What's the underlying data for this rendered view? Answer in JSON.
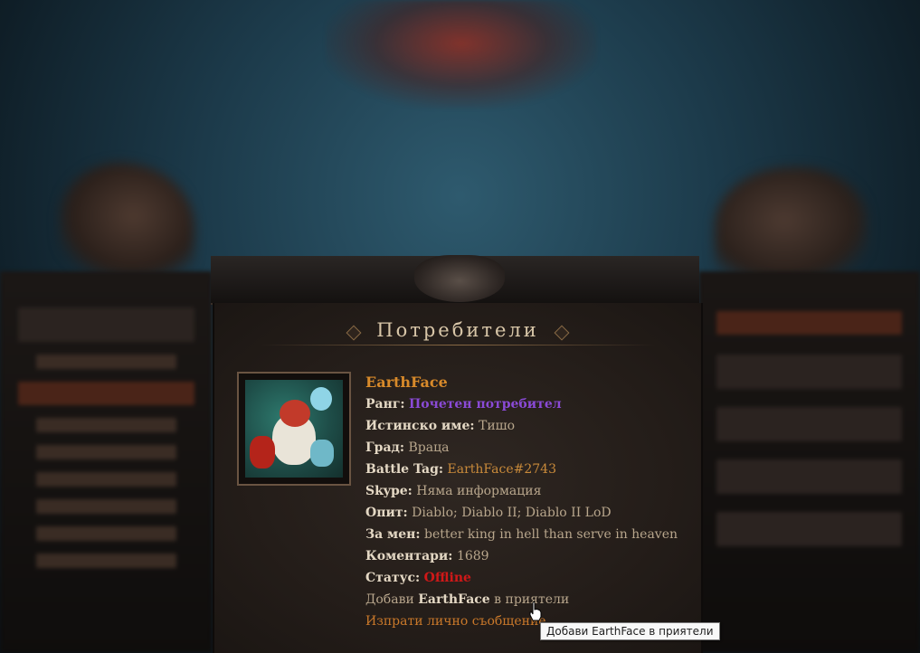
{
  "page": {
    "title": "Потребители"
  },
  "profile": {
    "username": "EarthFace",
    "rank_label": "Ранг:",
    "rank_value": "Почетен потребител",
    "real_name_label": "Истинско име:",
    "real_name_value": "Тишо",
    "city_label": "Град:",
    "city_value": "Враца",
    "battletag_label": "Battle Tag:",
    "battletag_value": "EarthFace#2743",
    "skype_label": "Skype:",
    "skype_value": "Няма информация",
    "experience_label": "Опит:",
    "experience_value": "Diablo; Diablo II; Diablo II LoD",
    "about_label": "За мен:",
    "about_value": "better king in hell than serve in heaven",
    "comments_label": "Коментари:",
    "comments_value": "1689",
    "status_label": "Статус:",
    "status_value": "Offline"
  },
  "actions": {
    "add_friend_prefix": "Добави",
    "add_friend_name": "EarthFace",
    "add_friend_suffix": "в приятели",
    "send_message": "Изпрати лично съобщение"
  },
  "tooltip": {
    "text": "Добави EarthFace в приятели"
  },
  "colors": {
    "rank": "#8a4ad6",
    "offline": "#d01818",
    "username": "#d88a2a",
    "link": "#c98a3a"
  }
}
